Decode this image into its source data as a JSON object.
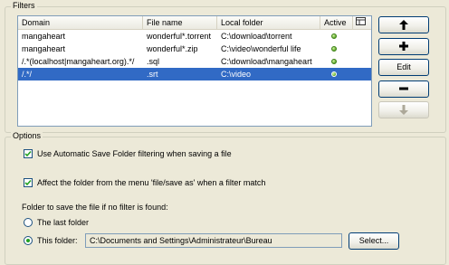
{
  "filters": {
    "title": "Filters",
    "columns": {
      "domain": "Domain",
      "file_name": "File name",
      "local_folder": "Local folder",
      "active": "Active",
      "column_picker_icon": "column-chooser-icon"
    },
    "rows": [
      {
        "domain": "mangaheart",
        "file_name": "wonderful*.torrent",
        "local_folder": "C:\\download\\torrent",
        "active": true,
        "selected": false
      },
      {
        "domain": "mangaheart",
        "file_name": "wonderful*.zip",
        "local_folder": "C:\\video\\wonderful life",
        "active": true,
        "selected": false
      },
      {
        "domain": "/.*(localhost|mangaheart.org).*/",
        "file_name": ".sql",
        "local_folder": "C:\\download\\mangaheart",
        "active": true,
        "selected": false
      },
      {
        "domain": "/.*/",
        "file_name": ".srt",
        "local_folder": "C:\\video",
        "active": true,
        "selected": true
      }
    ],
    "buttons": {
      "move_up_icon": "arrow-up-icon",
      "add_icon": "plus-icon",
      "edit_label": "Edit",
      "remove_icon": "minus-icon",
      "move_down_icon": "arrow-down-icon"
    }
  },
  "options": {
    "title": "Options",
    "auto_save_filter_label": "Use Automatic Save Folder filtering when saving a file",
    "auto_save_filter_checked": true,
    "affect_folder_label": "Affect the folder from the menu 'file/save as' when a filter match",
    "affect_folder_checked": true,
    "fallback_label": "Folder to save the file if no filter is found:",
    "last_folder_label": "The last folder",
    "this_folder_label": "This folder:",
    "selected_option": "this_folder",
    "folder_path": "C:\\Documents and Settings\\Administrateur\\Bureau",
    "select_label": "Select..."
  },
  "colors": {
    "selection": "#316ac5",
    "active_dot": "#5ea82a",
    "window_bg": "#ece9d8"
  }
}
